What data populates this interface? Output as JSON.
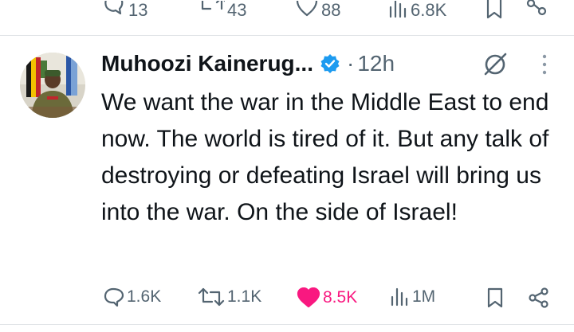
{
  "prev_tweet": {
    "replies": "13",
    "reposts": "43",
    "likes": "88",
    "views": "6.8K"
  },
  "tweet": {
    "author_name": "Muhoozi Kainerug...",
    "time": "12h",
    "separator": "·",
    "text": "We want the war in the Middle East to end now. The world is tired of it. But any talk of destroying or defeating Israel will bring us into the war. On the side of Israel!",
    "replies": "1.6K",
    "reposts": "1.1K",
    "likes": "8.5K",
    "views": "1M"
  },
  "icons": {
    "reply": "reply-icon",
    "repost": "repost-icon",
    "like": "heart-icon",
    "views": "views-icon",
    "bookmark": "bookmark-icon",
    "share": "share-icon",
    "verified": "verified-badge-icon",
    "grok": "grok-icon",
    "more": "more-icon"
  },
  "colors": {
    "accent_blue": "#1d9bf0",
    "like_pink": "#f91880",
    "muted": "#536471"
  }
}
